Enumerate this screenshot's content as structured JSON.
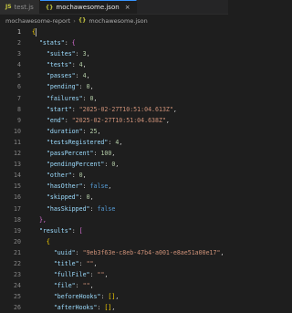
{
  "tabs": [
    {
      "label": "test.js",
      "icon": "js-icon",
      "active": false
    },
    {
      "label": "mochawesome.json",
      "icon": "json-icon",
      "active": true,
      "close": "×"
    }
  ],
  "breadcrumb": {
    "folder": "mochawesome-report",
    "separator": "›",
    "file_icon": "{}",
    "file": "mochawesome.json"
  },
  "editor": {
    "lines": [
      {
        "n": "1",
        "indent": "",
        "text": "{"
      },
      {
        "n": "2",
        "indent": "  ",
        "key": "\"stats\"",
        "colon": ": ",
        "value": "{",
        "vtype": "bracket"
      },
      {
        "n": "3",
        "indent": "    ",
        "key": "\"suites\"",
        "colon": ": ",
        "value": "3",
        "vtype": "num",
        "comma": ","
      },
      {
        "n": "4",
        "indent": "    ",
        "key": "\"tests\"",
        "colon": ": ",
        "value": "4",
        "vtype": "num",
        "comma": ","
      },
      {
        "n": "5",
        "indent": "    ",
        "key": "\"passes\"",
        "colon": ": ",
        "value": "4",
        "vtype": "num",
        "comma": ","
      },
      {
        "n": "6",
        "indent": "    ",
        "key": "\"pending\"",
        "colon": ": ",
        "value": "0",
        "vtype": "num",
        "comma": ","
      },
      {
        "n": "7",
        "indent": "    ",
        "key": "\"failures\"",
        "colon": ": ",
        "value": "0",
        "vtype": "num",
        "comma": ","
      },
      {
        "n": "8",
        "indent": "    ",
        "key": "\"start\"",
        "colon": ": ",
        "value": "\"2025-02-27T10:51:04.613Z\"",
        "vtype": "str",
        "comma": ","
      },
      {
        "n": "9",
        "indent": "    ",
        "key": "\"end\"",
        "colon": ": ",
        "value": "\"2025-02-27T10:51:04.638Z\"",
        "vtype": "str",
        "comma": ","
      },
      {
        "n": "10",
        "indent": "    ",
        "key": "\"duration\"",
        "colon": ": ",
        "value": "25",
        "vtype": "num",
        "comma": ","
      },
      {
        "n": "11",
        "indent": "    ",
        "key": "\"testsRegistered\"",
        "colon": ": ",
        "value": "4",
        "vtype": "num",
        "comma": ","
      },
      {
        "n": "12",
        "indent": "    ",
        "key": "\"passPercent\"",
        "colon": ": ",
        "value": "100",
        "vtype": "num",
        "comma": ","
      },
      {
        "n": "13",
        "indent": "    ",
        "key": "\"pendingPercent\"",
        "colon": ": ",
        "value": "0",
        "vtype": "num",
        "comma": ","
      },
      {
        "n": "14",
        "indent": "    ",
        "key": "\"other\"",
        "colon": ": ",
        "value": "0",
        "vtype": "num",
        "comma": ","
      },
      {
        "n": "15",
        "indent": "    ",
        "key": "\"hasOther\"",
        "colon": ": ",
        "value": "false",
        "vtype": "kw",
        "comma": ","
      },
      {
        "n": "16",
        "indent": "    ",
        "key": "\"skipped\"",
        "colon": ": ",
        "value": "0",
        "vtype": "num",
        "comma": ","
      },
      {
        "n": "17",
        "indent": "    ",
        "key": "\"hasSkipped\"",
        "colon": ": ",
        "value": "false",
        "vtype": "kw"
      },
      {
        "n": "18",
        "indent": "  ",
        "text": "},",
        "ttype": "bracket"
      },
      {
        "n": "19",
        "indent": "  ",
        "key": "\"results\"",
        "colon": ": ",
        "value": "[",
        "vtype": "bracket"
      },
      {
        "n": "20",
        "indent": "    ",
        "text": "{",
        "ttype": "brace2"
      },
      {
        "n": "21",
        "indent": "      ",
        "key": "\"uuid\"",
        "colon": ": ",
        "value": "\"9eb3f63e-c8eb-47b4-a001-e8ae51a00e17\"",
        "vtype": "str",
        "comma": ","
      },
      {
        "n": "22",
        "indent": "      ",
        "key": "\"title\"",
        "colon": ": ",
        "value": "\"\"",
        "vtype": "str",
        "comma": ","
      },
      {
        "n": "23",
        "indent": "      ",
        "key": "\"fullFile\"",
        "colon": ": ",
        "value": "\"\"",
        "vtype": "str",
        "comma": ","
      },
      {
        "n": "24",
        "indent": "      ",
        "key": "\"file\"",
        "colon": ": ",
        "value": "\"\"",
        "vtype": "str",
        "comma": ","
      },
      {
        "n": "25",
        "indent": "      ",
        "key": "\"beforeHooks\"",
        "colon": ": ",
        "value": "[]",
        "vtype": "bracket2",
        "comma": ","
      },
      {
        "n": "26",
        "indent": "      ",
        "key": "\"afterHooks\"",
        "colon": ": ",
        "value": "[]",
        "vtype": "bracket2",
        "comma": ","
      }
    ]
  }
}
